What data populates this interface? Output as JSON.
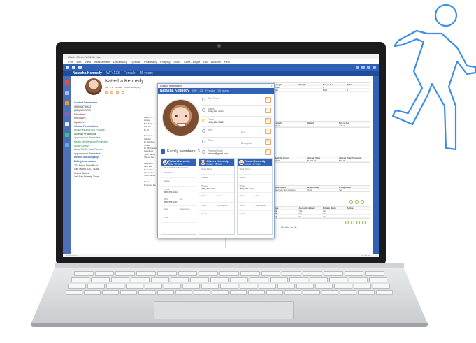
{
  "app": {
    "window_title": "Oasis Client (1.0.1.0) Live",
    "menu": [
      "File",
      "Edit",
      "View",
      "Assessment",
      "Dispensary",
      "Episode",
      "Pharmacy",
      "Imaging",
      "Clinic",
      "CHM-Ledger",
      "Bill",
      "Window",
      "Help"
    ],
    "status_left": "Oasis Client",
    "status_right": "11:42 AM"
  },
  "patient": {
    "name": "Natasha Kennedy",
    "chart_no": "WF: 173",
    "sex": "Female",
    "age": "35 years",
    "dob": "29-Oct-1983 (35y)",
    "dob_short": "35y",
    "sidebar": [
      {
        "text": "Contact Information",
        "style": "hdr"
      },
      {
        "text": "(888) 687-6823",
        "style": "plain"
      },
      {
        "text": "(888) 591-5712",
        "style": "plain"
      },
      {
        "text": "Bloodwell",
        "style": "red"
      },
      {
        "text": "Microgarnt",
        "style": "plain"
      },
      {
        "text": "Inpatient",
        "style": "red"
      },
      {
        "text": "Clinical Permissions",
        "style": "hdr"
      },
      {
        "text": "Allow Results From Practice",
        "style": "green"
      },
      {
        "text": "Access Permissions",
        "style": "plain"
      },
      {
        "text": "Appointment Reminders",
        "style": "green"
      },
      {
        "text": "Health Maintenance Reminders",
        "style": "green"
      },
      {
        "text": "Allow Surveys",
        "style": "green"
      },
      {
        "text": "Allow CMCS Data Transfer",
        "style": "green"
      },
      {
        "text": "Appointment Reminders",
        "style": "plain"
      },
      {
        "text": "Default Subcompany",
        "style": "hdr"
      },
      {
        "text": "Billing Information",
        "style": "hdr"
      },
      {
        "text": "752 Birtus Drive Road",
        "style": "plain"
      },
      {
        "text": "San Martin, CA - 31568",
        "style": "plain"
      },
      {
        "text": "United States",
        "style": "plain"
      },
      {
        "text": "Self  Pay  Primary Ticket",
        "style": "plain"
      }
    ]
  },
  "middle_column": {
    "lines": [
      "Patient I...",
      "Active",
      "Bal. Statu...",
      "Ace ID:",
      "Dr. N",
      "",
      "Providers",
      "Clinical",
      "Dr. DeClero",
      "Nurse",
      "Dr. MaClassed",
      "Insurance",
      "Scott Helius",
      "Thyme Dalt",
      "",
      "Appointm...",
      "Last Visit",
      "Next Visit",
      "Chloe Ven",
      "Scott Helius",
      "",
      "Notes",
      "Notes on file"
    ]
  },
  "grids": {
    "vitals": {
      "headers": [
        "Length",
        "Weight",
        "Due to Do",
        "Table"
      ],
      "rows": [
        [
          "Chart",
          "",
          "A",
          ""
        ],
        [
          "Tall",
          "",
          "BHD",
          "1"
        ]
      ]
    },
    "history": {
      "headers": [
        "Length",
        "Weight",
        "Due to Do"
      ],
      "rows": [
        [
          "Chart",
          "4",
          "4 AmG"
        ]
      ]
    },
    "billing": {
      "headers": [
        "Bed Bld Given",
        "Charge Plans",
        "Charge Paid Payments"
      ],
      "rows": [
        [
          "$0.00",
          "$1,000.00",
          "$26.00"
        ]
      ]
    },
    "care": {
      "headers": [
        "Date Given",
        "Relationship",
        "Assignment"
      ],
      "rows": [
        [
          "Kennedy, Eric Fathers",
          "Child",
          "Yes"
        ]
      ]
    },
    "family_grid": {
      "headers": [
        "Age",
        "Account Holder",
        "Private Mem",
        "Active"
      ],
      "rows": [
        [
          "33",
          "Yes",
          "Yes",
          ""
        ],
        [
          "28",
          "Yes",
          "Yes",
          ""
        ],
        [
          "15",
          "No",
          "Yes",
          ""
        ]
      ]
    }
  },
  "no_data": "No data on file.",
  "dialog": {
    "title": "Contact Information",
    "header_name": "Natasha Kennedy",
    "header_meta_1": "WF: 173",
    "header_meta_2": "Female",
    "header_meta_3": "35 years",
    "fields": [
      {
        "label": "Work Phone",
        "value": "",
        "icon": "phone-icon"
      },
      {
        "label": "Mobile",
        "value": "(586) 555-6813",
        "icon": "mobile-icon"
      },
      {
        "label": "Phone",
        "value": "(405) 555-9822",
        "icon": "star-icon"
      },
      {
        "label": "Work",
        "value": "",
        "right_label": "Ext",
        "icon": "clock-icon"
      },
      {
        "label": "Other",
        "value": "",
        "right_label": "Description",
        "icon": "user-icon"
      },
      {
        "label": "Personal Email",
        "value": "ntkmed@gmail.com",
        "icon": "email-icon"
      }
    ],
    "family_title": "Family Members",
    "family_count": "3",
    "members": [
      {
        "name": "Robert Kennedy",
        "meta": "Male · 38 Years",
        "subtitle": "Principal Medical Beneficiaries",
        "work_label": "Work Phone",
        "mobile_label": "Mobile",
        "phone_label": "Phone",
        "phone_value": "(888) 651-2222",
        "work_line_label": "Work",
        "work_line_value": "(888) 555-6321",
        "ext_label": "Ext",
        "other_label": "Other",
        "desc_label": "Description",
        "email_label": "Email"
      },
      {
        "name": "Olivera Kennedy",
        "meta": "Female · 28 Years",
        "subtitle": "",
        "work_label": "Work Phone",
        "mobile_label": "Mobile",
        "phone_label": "Phone",
        "phone_value": "(888) 651-2222",
        "work_line_label": "Work",
        "work_line_value": "",
        "ext_label": "Ext",
        "other_label": "Other",
        "desc_label": "Description",
        "email_label": "Email"
      },
      {
        "name": "Trisha Kennedy",
        "meta": "Female · 15 Years",
        "subtitle": "",
        "work_label": "Work Phone",
        "mobile_label": "Mobile",
        "phone_label": "Phone",
        "phone_value": "(888) 651-2222",
        "work_line_label": "Work",
        "work_line_value": "",
        "ext_label": "Ext",
        "other_label": "Other",
        "desc_label": "Description",
        "email_label": "Email"
      }
    ]
  },
  "colors": {
    "brand_blue": "#2f62b6",
    "header_blue": "#1f4d9a",
    "accent_orange": "#f2a55a",
    "runner_stroke": "#3d8ee6"
  },
  "icons": {
    "runner": "running-person-icon",
    "edit": "pencil-icon"
  }
}
